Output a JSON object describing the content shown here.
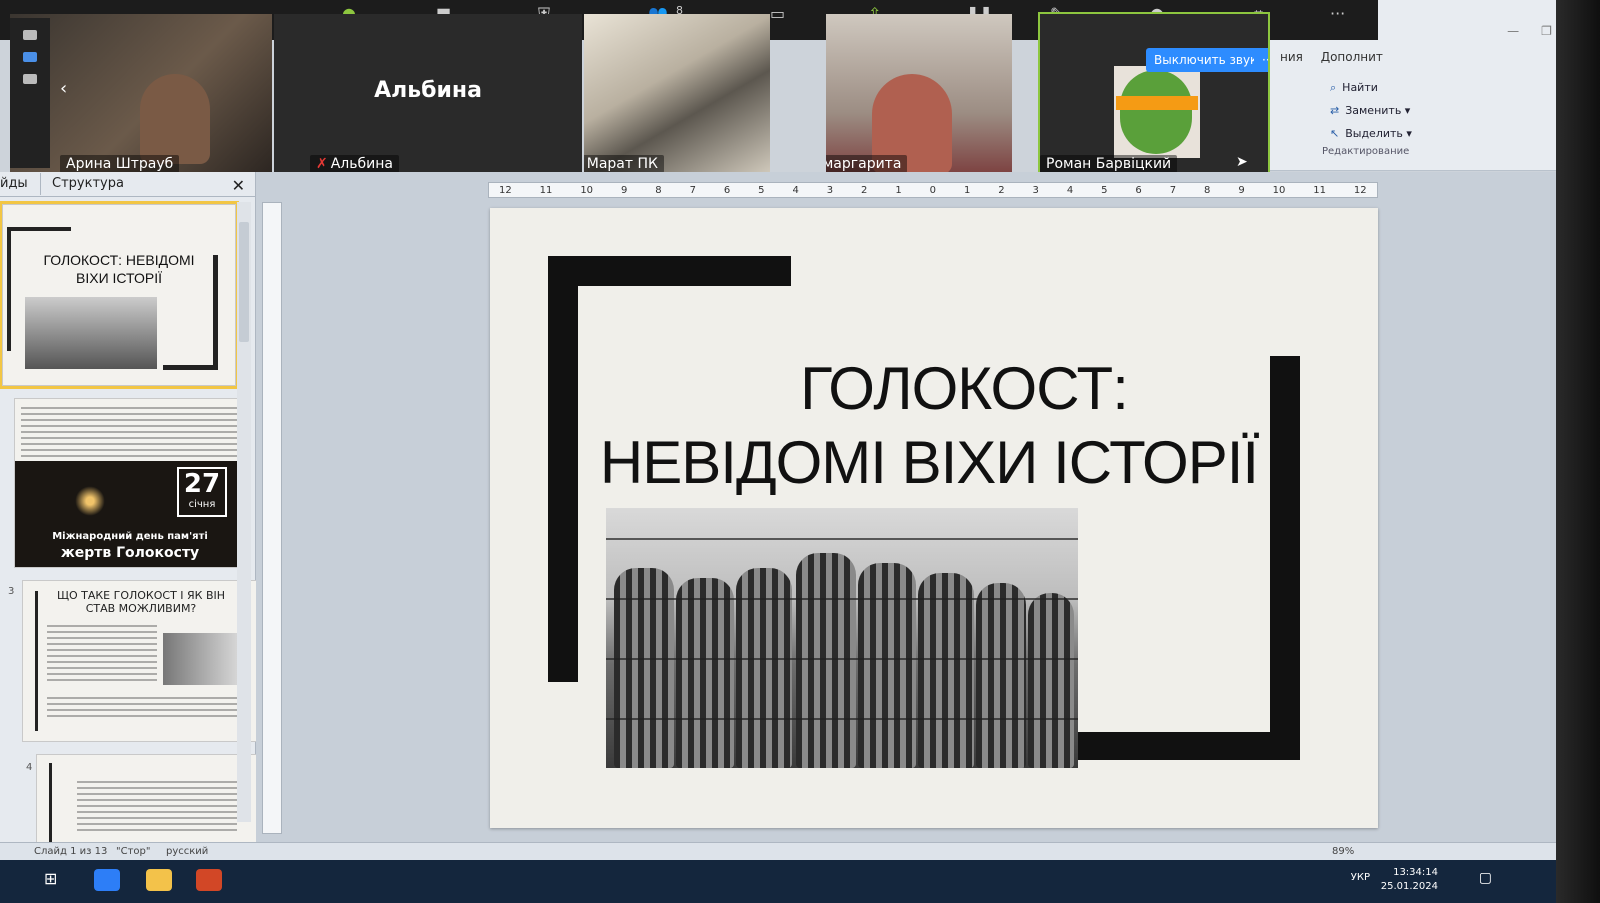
{
  "zoom": {
    "participants_count": "8",
    "tiles": [
      {
        "name": "Арина Штрауб",
        "muted": false,
        "big_name": ""
      },
      {
        "name": "Альбина",
        "muted": true,
        "big_name": "Альбина"
      },
      {
        "name": "Марат ПК",
        "muted": true,
        "big_name": ""
      },
      {
        "name": "маргарита",
        "muted": true,
        "big_name": ""
      },
      {
        "name": "Роман Барвіцкий",
        "muted": false,
        "big_name": ""
      }
    ],
    "unmute_label": "Выключить звук",
    "more_label": "···"
  },
  "ribbon": {
    "tabs": [
      "ния",
      "Дополнит"
    ],
    "edit_items": [
      "Найти",
      "Заменить ▾",
      "Выделить ▾"
    ],
    "group_label": "Редактирование"
  },
  "panel": {
    "tab_slides": "йды",
    "tab_outline": "Структура",
    "close": "✕"
  },
  "thumbs": [
    {
      "num": "",
      "title": "ГОЛОКОСТ: НЕВІДОМІ ВІХИ ІСТОРІЇ"
    },
    {
      "num": "",
      "date_num": "27",
      "date_month": "січня",
      "caption1": "Міжнародний день пам'яті",
      "caption2": "жертв Голокосту"
    },
    {
      "num": "3",
      "title": "ЩО ТАКЕ ГОЛОКОСТ І ЯК ВІН СТАВ МОЖЛИВИМ?"
    },
    {
      "num": "4",
      "title": ""
    }
  ],
  "slide": {
    "title_line1": "ГОЛОКОСТ:",
    "title_line2": "НЕВІДОМІ ВІХИ ІСТОРІЇ"
  },
  "ruler": {
    "ticks": [
      "12",
      "11",
      "10",
      "9",
      "8",
      "7",
      "6",
      "5",
      "4",
      "3",
      "2",
      "1",
      "0",
      "1",
      "2",
      "3",
      "4",
      "5",
      "6",
      "7",
      "8",
      "9",
      "10",
      "11",
      "12"
    ]
  },
  "status": {
    "slide_info": "Слайд 1 из 13",
    "theme": "\"Стор\"",
    "lang": "русский",
    "zoom_pct": "89%"
  },
  "taskbar": {
    "lang": "УКР",
    "time": "13:34:14",
    "date": "25.01.2024"
  }
}
